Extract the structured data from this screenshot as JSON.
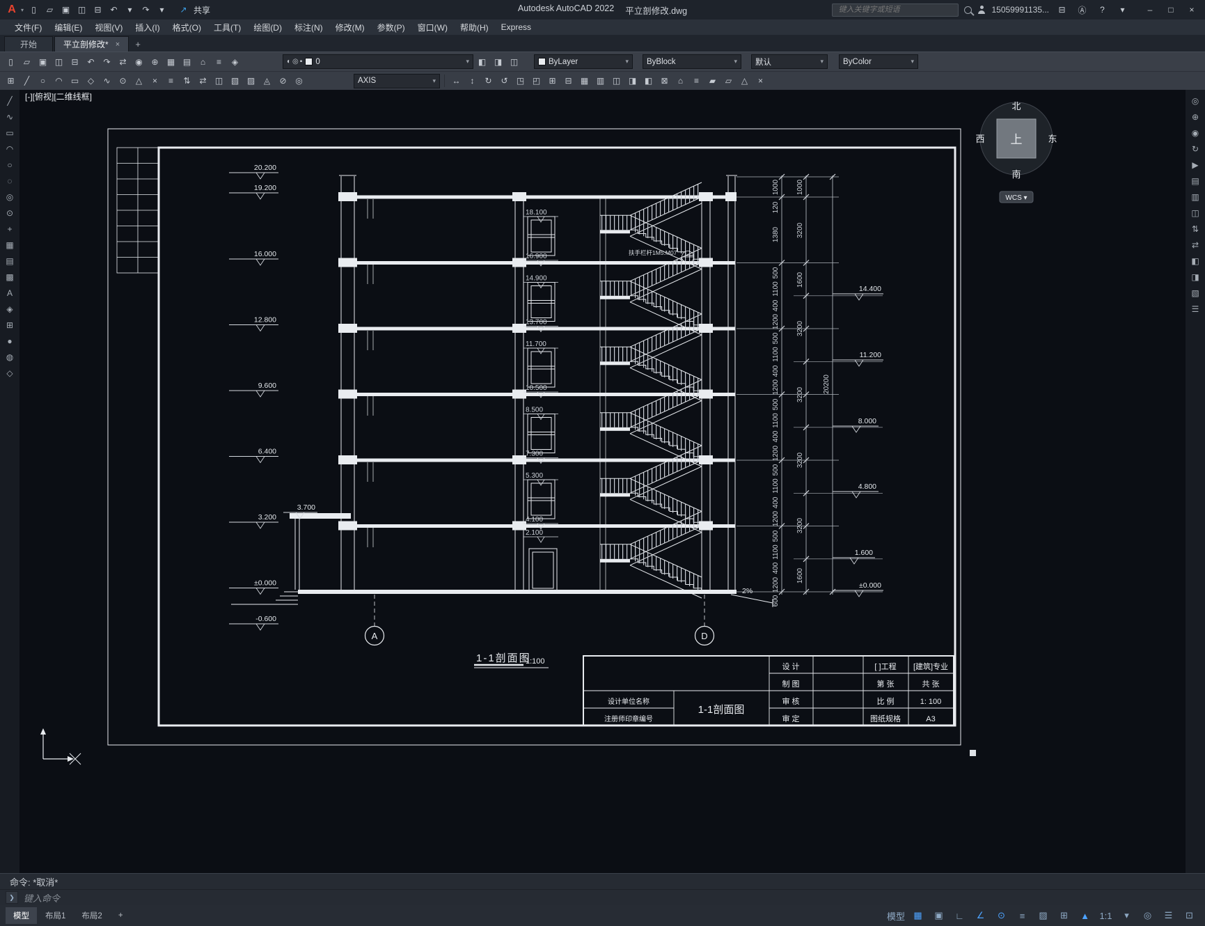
{
  "icons": {
    "caret": "▾",
    "close": "×",
    "plus": "+",
    "min": "–",
    "max": "□",
    "win_close": "×"
  },
  "titlebar": {
    "app_name": "Autodesk AutoCAD 2022",
    "doc_name": "平立剖修改.dwg",
    "share_label": "共享",
    "share_icon": "↗",
    "search_placeholder": "键入关键字或短语",
    "account": "15059991135...",
    "qat": [
      {
        "g": "▯",
        "n": "qat-new-icon"
      },
      {
        "g": "▱",
        "n": "qat-open-icon"
      },
      {
        "g": "▣",
        "n": "qat-save-icon"
      },
      {
        "g": "◫",
        "n": "qat-saveas-icon"
      },
      {
        "g": "⊟",
        "n": "qat-plot-icon"
      },
      {
        "g": "↶",
        "n": "qat-undo-icon"
      },
      {
        "g": "▾",
        "n": "qat-undo-caret-icon"
      },
      {
        "g": "↷",
        "n": "qat-redo-icon"
      },
      {
        "g": "▾",
        "n": "qat-redo-caret-icon"
      }
    ]
  },
  "menus": [
    "文件(F)",
    "编辑(E)",
    "视图(V)",
    "插入(I)",
    "格式(O)",
    "工具(T)",
    "绘图(D)",
    "标注(N)",
    "修改(M)",
    "参数(P)",
    "窗口(W)",
    "帮助(H)",
    "Express"
  ],
  "tabs": {
    "start": "开始",
    "doc": "平立剖修改*"
  },
  "ribbon1": {
    "icons": [
      {
        "g": "▯",
        "n": "new-icon"
      },
      {
        "g": "▱",
        "n": "open-icon"
      },
      {
        "g": "▣",
        "n": "save-icon"
      },
      {
        "g": "◫",
        "n": "saveas-icon"
      },
      {
        "g": "⊟",
        "n": "plot-icon"
      },
      {
        "g": "↶",
        "n": "undo-icon"
      },
      {
        "g": "↷",
        "n": "redo-icon"
      },
      {
        "g": "⇄",
        "n": "match-properties-icon"
      },
      {
        "g": "◉",
        "n": "zoom-icon"
      },
      {
        "g": "⊕",
        "n": "pan-icon"
      },
      {
        "g": "▦",
        "n": "hatch-icon"
      },
      {
        "g": "▤",
        "n": "layer-properties-icon"
      },
      {
        "g": "⌂",
        "n": "home-icon"
      },
      {
        "g": "≡",
        "n": "properties-icon"
      },
      {
        "g": "◈",
        "n": "block-icon"
      }
    ],
    "layer_icons": [
      {
        "g": "◐",
        "n": "layer-on-icon"
      },
      {
        "g": "◎",
        "n": "layer-freeze-icon"
      },
      {
        "g": "▪",
        "n": "layer-lock-icon"
      }
    ],
    "layer_value": "0",
    "after_icons": [
      {
        "g": "◧",
        "n": "layer-state-icon"
      },
      {
        "g": "◨",
        "n": "layer-prev-icon"
      },
      {
        "g": "◫",
        "n": "layer-match-icon"
      }
    ],
    "color_value": "ByLayer",
    "linetype_value": "ByBlock",
    "lineweight_value": "默认",
    "plotstyle_value": "ByColor"
  },
  "ribbon2": {
    "icons_left": [
      {
        "g": "⊞",
        "n": "snap-grid-icon"
      },
      {
        "g": "╱",
        "n": "line-icon"
      },
      {
        "g": "○",
        "n": "circle-icon"
      },
      {
        "g": "◠",
        "n": "arc-icon"
      },
      {
        "g": "▭",
        "n": "rectangle-icon"
      },
      {
        "g": "◇",
        "n": "polygon-icon"
      },
      {
        "g": "∿",
        "n": "spline-icon"
      },
      {
        "g": "⊙",
        "n": "donut-icon"
      },
      {
        "g": "△",
        "n": "triangle-icon"
      },
      {
        "g": "×",
        "n": "erase-icon"
      },
      {
        "g": "≡",
        "n": "layers-icon"
      },
      {
        "g": "⇅",
        "n": "move-vertical-icon"
      },
      {
        "g": "⇄",
        "n": "move-horizontal-icon"
      },
      {
        "g": "◫",
        "n": "viewport-icon"
      },
      {
        "g": "▧",
        "n": "hatch-left-icon"
      },
      {
        "g": "▨",
        "n": "hatch-right-icon"
      },
      {
        "g": "◬",
        "n": "cone-icon"
      },
      {
        "g": "⊘",
        "n": "trim-icon"
      },
      {
        "g": "◎",
        "n": "ellipse-icon"
      }
    ],
    "style_value": "AXIS",
    "icons_right": [
      {
        "g": "↔",
        "n": "stretch-icon"
      },
      {
        "g": "↕",
        "n": "extend-icon"
      },
      {
        "g": "↻",
        "n": "rotate-icon"
      },
      {
        "g": "↺",
        "n": "rotate-ccw-icon"
      },
      {
        "g": "◳",
        "n": "array-icon"
      },
      {
        "g": "◰",
        "n": "mirror-icon"
      },
      {
        "g": "⊞",
        "n": "grid-icon"
      },
      {
        "g": "⊟",
        "n": "ungroup-icon"
      },
      {
        "g": "▦",
        "n": "table-icon"
      },
      {
        "g": "▥",
        "n": "rows-icon"
      },
      {
        "g": "◫",
        "n": "columns-icon"
      },
      {
        "g": "◨",
        "n": "fillet-icon"
      },
      {
        "g": "◧",
        "n": "chamfer-icon"
      },
      {
        "g": "⊠",
        "n": "break-icon"
      },
      {
        "g": "⌂",
        "n": "base-icon"
      },
      {
        "g": "≡",
        "n": "list-icon"
      },
      {
        "g": "▰",
        "n": "solid-icon"
      },
      {
        "g": "▱",
        "n": "wireframe-icon"
      },
      {
        "g": "△",
        "n": "measure-icon"
      },
      {
        "g": "×",
        "n": "delete-icon"
      }
    ]
  },
  "left_palette": [
    {
      "g": "╱",
      "n": "line-tool-icon"
    },
    {
      "g": "∿",
      "n": "polyline-tool-icon"
    },
    {
      "g": "▭",
      "n": "rectangle-tool-icon"
    },
    {
      "g": "◠",
      "n": "arc-tool-icon"
    },
    {
      "g": "○",
      "n": "circle-tool-icon"
    },
    {
      "g": "◌",
      "n": "revcloud-tool-icon"
    },
    {
      "g": "◎",
      "n": "ellipse-tool-icon"
    },
    {
      "g": "⊙",
      "n": "donut-tool-icon"
    },
    {
      "g": "+",
      "n": "point-tool-icon"
    },
    {
      "g": "▦",
      "n": "hatch-tool-icon"
    },
    {
      "g": "▤",
      "n": "gradient-tool-icon"
    },
    {
      "g": "▩",
      "n": "table-tool-icon"
    },
    {
      "g": "A",
      "n": "text-tool-icon"
    },
    {
      "g": "◈",
      "n": "block-tool-icon"
    },
    {
      "g": "⊞",
      "n": "insert-tool-icon"
    },
    {
      "g": "●",
      "n": "region-tool-icon"
    },
    {
      "g": "◍",
      "n": "wipeout-tool-icon"
    },
    {
      "g": "◇",
      "n": "polygon-tool-icon"
    }
  ],
  "right_palette": [
    {
      "g": "◎",
      "n": "steering-wheel-icon"
    },
    {
      "g": "⊕",
      "n": "pan-tool-icon"
    },
    {
      "g": "◉",
      "n": "zoom-tool-icon"
    },
    {
      "g": "↻",
      "n": "orbit-tool-icon"
    },
    {
      "g": "▶",
      "n": "showmotion-icon"
    },
    {
      "g": "▤",
      "n": "layer-panel-icon"
    },
    {
      "g": "▥",
      "n": "properties-panel-icon"
    },
    {
      "g": "◫",
      "n": "sheet-set-icon"
    },
    {
      "g": "⇅",
      "n": "scroll-vertical-icon"
    },
    {
      "g": "⇄",
      "n": "scroll-horizontal-icon"
    },
    {
      "g": "◧",
      "n": "view-left-icon"
    },
    {
      "g": "◨",
      "n": "view-right-icon"
    },
    {
      "g": "▧",
      "n": "visual-style-icon"
    },
    {
      "g": "☰",
      "n": "palette-menu-icon"
    }
  ],
  "viewport_label": "[-][俯视][二维线框]",
  "viewcube": {
    "north": "北",
    "south": "南",
    "west": "西",
    "east": "东",
    "top": "上",
    "wcs": "WCS ▾"
  },
  "drawing": {
    "left_elevs": [
      "20.200",
      "19.200",
      "16.000",
      "12.800",
      "9.600",
      "6.400",
      "3.200",
      "±0.000",
      "-0.600"
    ],
    "canopy_elev": "3.700",
    "floor_labels": [
      "18.100",
      "16.900",
      "14.900",
      "13.700",
      "11.700",
      "10.500",
      "8.500",
      "7.300",
      "5.300",
      "4.100",
      "2.100"
    ],
    "right_elevs": [
      "14.400",
      "11.200",
      "8.000",
      "4.800",
      "1.600",
      "±0.000"
    ],
    "chain1": [
      "1000",
      "120",
      "1380",
      "500",
      "1100",
      "400",
      "1200",
      "500",
      "1100",
      "400",
      "1200",
      "500",
      "1100",
      "400",
      "1200",
      "500",
      "1100",
      "400",
      "1200",
      "500",
      "1100",
      "400",
      "1200",
      "600"
    ],
    "chain2": [
      "1000",
      "3200",
      "1600",
      "3200",
      "3200",
      "3200",
      "3200",
      "1600"
    ],
    "total_dim": "20200",
    "grid_a": "A",
    "grid_d": "D",
    "slope": "2%",
    "stair_note": "扶手栏杆1M5.M07",
    "title": "1-1剖面图",
    "scale": "1:100"
  },
  "titleblock": {
    "design": "设  计",
    "draft": "制  图",
    "check": "审  核",
    "approve": "审  定",
    "project": "[ ]工程",
    "major": "[建筑]专业",
    "sheet_no": "第  张",
    "sheet_total": "共  张",
    "scale_label": "比  例",
    "scale_value": "1: 100",
    "size_label": "图纸规格",
    "size_value": "A3",
    "org_label": "设计单位名称",
    "cert_label": "注册师印章编号",
    "drawing_name": "1-1剖面图"
  },
  "command": {
    "history": "命令: *取消*",
    "prompt_icon": "❯",
    "placeholder": "键入命令"
  },
  "statusbar": {
    "layout_tabs": [
      "模型",
      "布局1",
      "布局2",
      "+"
    ],
    "icons": [
      {
        "g": "模型",
        "n": "model-space-button",
        "on": "0"
      },
      {
        "g": "▦",
        "n": "grid-display-icon",
        "on": "1"
      },
      {
        "g": "▣",
        "n": "snap-mode-icon",
        "on": "0"
      },
      {
        "g": "∟",
        "n": "ortho-mode-icon",
        "on": "0"
      },
      {
        "g": "∠",
        "n": "polar-tracking-icon",
        "on": "1"
      },
      {
        "g": "⊙",
        "n": "object-snap-icon",
        "on": "1"
      },
      {
        "g": "≡",
        "n": "lineweight-display-icon",
        "on": "0"
      },
      {
        "g": "▨",
        "n": "transparency-icon",
        "on": "0"
      },
      {
        "g": "⊞",
        "n": "selection-cycling-icon",
        "on": "0"
      },
      {
        "g": "▲",
        "n": "annotation-visibility-icon",
        "on": "1"
      },
      {
        "g": "1:1",
        "n": "annotation-scale-button",
        "on": "0"
      },
      {
        "g": "▾",
        "n": "scale-caret-icon",
        "on": "0"
      },
      {
        "g": "◎",
        "n": "workspace-switch-icon",
        "on": "0"
      },
      {
        "g": "☰",
        "n": "customize-icon",
        "on": "0"
      },
      {
        "g": "⊡",
        "n": "clean-screen-icon",
        "on": "0"
      }
    ]
  }
}
